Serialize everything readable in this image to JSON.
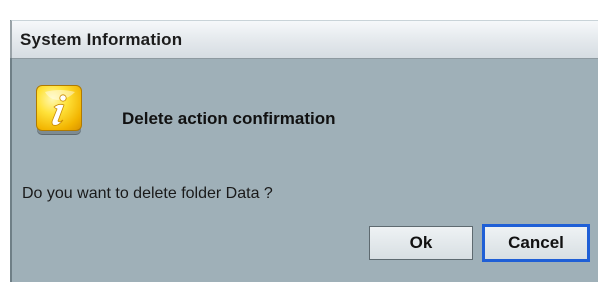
{
  "window": {
    "title": "System Information"
  },
  "dialog": {
    "icon": "info-icon",
    "heading": "Delete action confirmation",
    "message": "Do you want to delete folder Data ?"
  },
  "buttons": {
    "ok_label": "Ok",
    "cancel_label": "Cancel"
  },
  "colors": {
    "dialog_background": "#9fb0b8",
    "focus_border": "#1f5fd6",
    "icon_yellow": "#ffe23a"
  }
}
